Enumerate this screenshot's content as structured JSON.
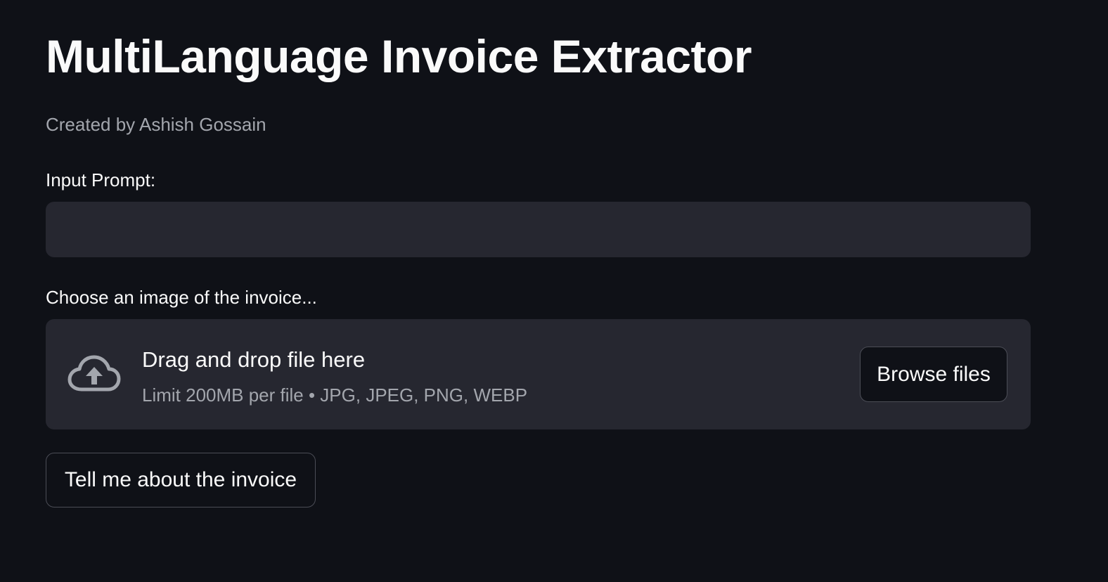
{
  "header": {
    "title": "MultiLanguage Invoice Extractor",
    "caption": "Created by Ashish Gossain"
  },
  "prompt_input": {
    "label": "Input Prompt:",
    "value": ""
  },
  "file_uploader": {
    "label": "Choose an image of the invoice...",
    "icon": "cloud-upload-icon",
    "drop_text": "Drag and drop file here",
    "limit_text": "Limit 200MB per file • JPG, JPEG, PNG, WEBP",
    "browse_label": "Browse files"
  },
  "submit_button": {
    "label": "Tell me about the invoice"
  },
  "colors": {
    "background": "#0f1117",
    "input_background": "#262730",
    "text": "#fafafa",
    "muted_text": "#a3a6ad",
    "button_border": "#4b4d56"
  }
}
